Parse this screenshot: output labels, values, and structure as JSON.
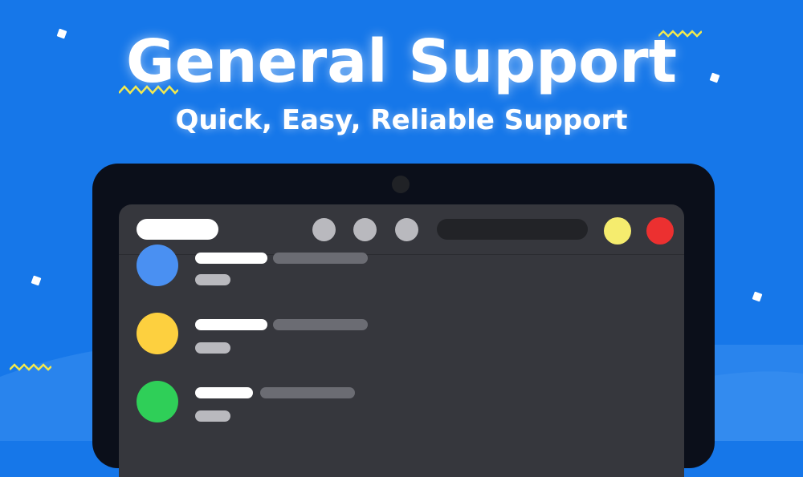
{
  "banner": {
    "title": "General Support",
    "subtitle": "Quick, Easy, Reliable Support"
  },
  "colors": {
    "background": "#1677e9",
    "wave": "#3b8ff0",
    "laptop_frame": "#0b0f1a",
    "screen": "#36373d",
    "zigzag": "#f2e94e",
    "minimize": "#f5ec6e",
    "close": "#ec3030"
  },
  "icons": {
    "camera": "webcam-icon",
    "minimize": "yellow-window-button",
    "close": "red-window-button"
  },
  "contacts": [
    {
      "avatar_color": "#4a90f2"
    },
    {
      "avatar_color": "#fdd03f"
    },
    {
      "avatar_color": "#2fcf58"
    }
  ]
}
